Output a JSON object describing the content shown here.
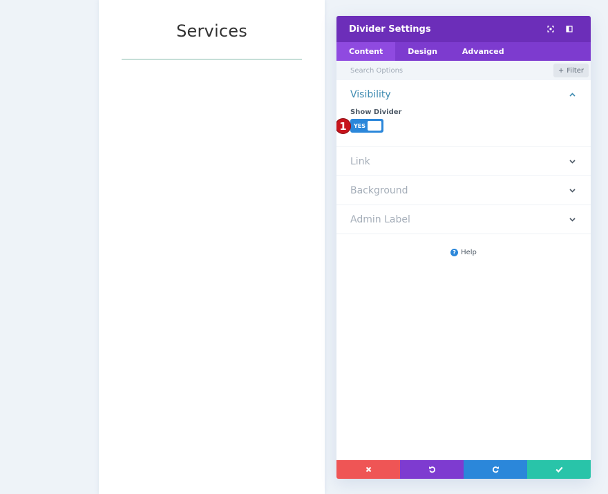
{
  "page": {
    "heading": "Services",
    "divider_color": "#c6dfd8"
  },
  "panel": {
    "title": "Divider Settings",
    "header_icons": [
      "fullscreen-icon",
      "sidebar-toggle-icon"
    ],
    "tabs": [
      {
        "label": "Content",
        "active": true
      },
      {
        "label": "Design",
        "active": false
      },
      {
        "label": "Advanced",
        "active": false
      }
    ],
    "search": {
      "placeholder": "Search Options",
      "value": ""
    },
    "filter_label": "Filter",
    "sections": [
      {
        "title": "Visibility",
        "open": true,
        "fields": [
          {
            "label": "Show Divider",
            "type": "toggle",
            "value": "YES",
            "badge": "1"
          }
        ]
      },
      {
        "title": "Link",
        "open": false
      },
      {
        "title": "Background",
        "open": false
      },
      {
        "title": "Admin Label",
        "open": false
      }
    ],
    "help_label": "Help",
    "footer": {
      "buttons": [
        {
          "name": "discard",
          "icon": "close-icon",
          "color": "#ef5555"
        },
        {
          "name": "undo",
          "icon": "undo-icon",
          "color": "#7e3bd0"
        },
        {
          "name": "redo",
          "icon": "redo-icon",
          "color": "#2b87da"
        },
        {
          "name": "save",
          "icon": "checkmark-icon",
          "color": "#29c4a9"
        }
      ]
    }
  },
  "colors": {
    "header": "#6c2eb9",
    "tabs": "#7d3bcf",
    "active_tab": "#8f4ae0",
    "toggle": "#2b87da",
    "badge": "#c7141c",
    "open_section_title": "#3e8bb1"
  }
}
